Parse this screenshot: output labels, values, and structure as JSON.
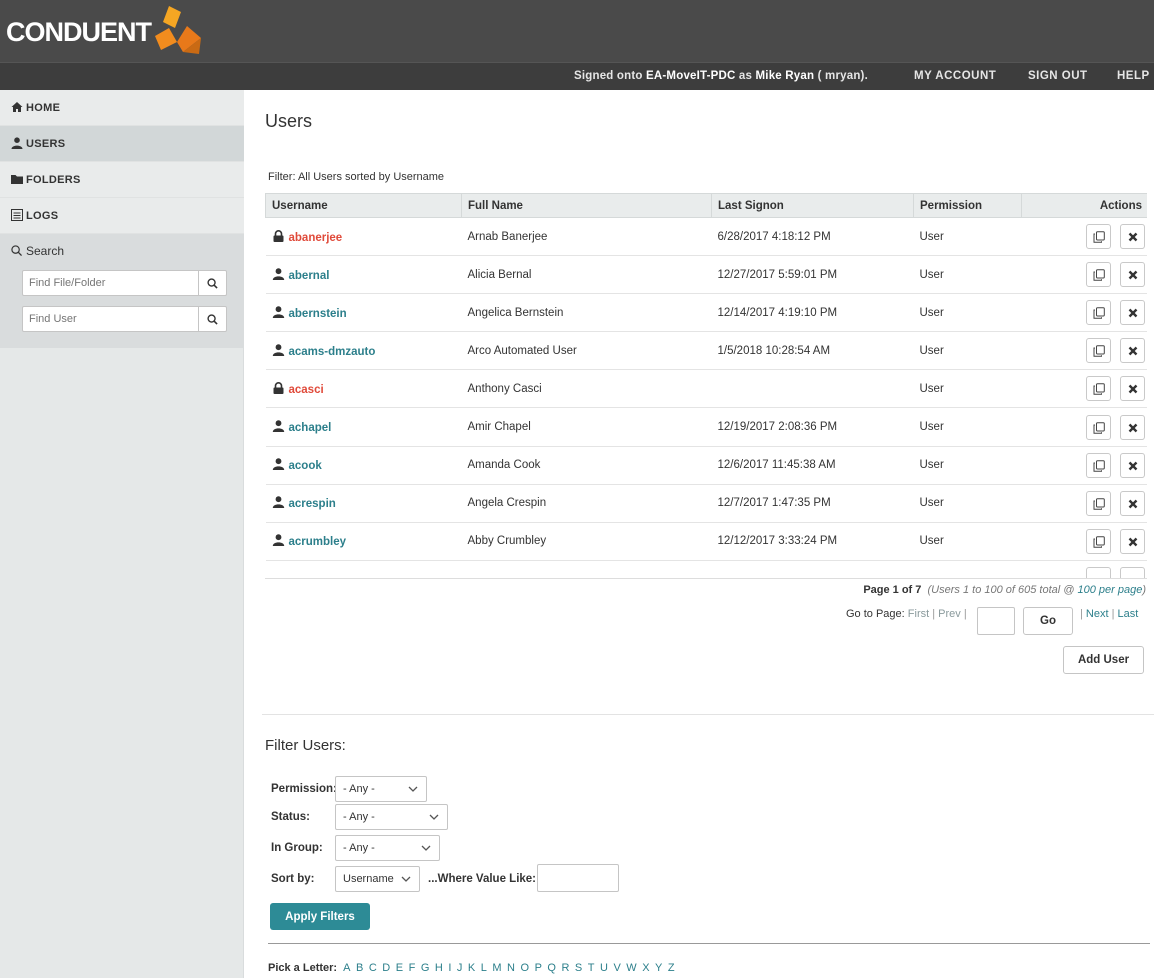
{
  "header": {
    "logo_text": "CONDUENT",
    "signed_prefix": "Signed onto ",
    "server": "EA-MoveIT-PDC",
    "signed_as": " as ",
    "user_display": "Mike Ryan",
    "user_id_text": " ( mryan).",
    "nav": {
      "my_account": "MY ACCOUNT",
      "sign_out": "SIGN OUT",
      "help": "HELP"
    }
  },
  "sidebar": {
    "items": [
      {
        "label": "HOME",
        "icon": "home-icon"
      },
      {
        "label": "USERS",
        "icon": "user-icon"
      },
      {
        "label": "FOLDERS",
        "icon": "folder-icon"
      },
      {
        "label": "LOGS",
        "icon": "logs-icon"
      }
    ],
    "search_title": "Search",
    "find_file_placeholder": "Find File/Folder",
    "find_user_placeholder": "Find User"
  },
  "main": {
    "title": "Users",
    "filter_text": "Filter: All Users sorted by Username",
    "columns": [
      "Username",
      "Full Name",
      "Last Signon",
      "Permission",
      "Actions"
    ],
    "rows": [
      {
        "username": "abanerjee",
        "full_name": "Arnab Banerjee",
        "last_signon": "6/28/2017 4:18:12 PM",
        "permission": "User",
        "locked": true
      },
      {
        "username": "abernal",
        "full_name": "Alicia Bernal",
        "last_signon": "12/27/2017 5:59:01 PM",
        "permission": "User",
        "locked": false
      },
      {
        "username": "abernstein",
        "full_name": "Angelica Bernstein",
        "last_signon": "12/14/2017 4:19:10 PM",
        "permission": "User",
        "locked": false
      },
      {
        "username": "acams-dmzauto",
        "full_name": "Arco Automated User",
        "last_signon": "1/5/2018 10:28:54 AM",
        "permission": "User",
        "locked": false
      },
      {
        "username": "acasci",
        "full_name": "Anthony Casci",
        "last_signon": "",
        "permission": "User",
        "locked": true
      },
      {
        "username": "achapel",
        "full_name": "Amir Chapel",
        "last_signon": "12/19/2017 2:08:36 PM",
        "permission": "User",
        "locked": false
      },
      {
        "username": "acook",
        "full_name": "Amanda Cook",
        "last_signon": "12/6/2017 11:45:38 AM",
        "permission": "User",
        "locked": false
      },
      {
        "username": "acrespin",
        "full_name": "Angela Crespin",
        "last_signon": "12/7/2017 1:47:35 PM",
        "permission": "User",
        "locked": false
      },
      {
        "username": "acrumbley",
        "full_name": "Abby Crumbley",
        "last_signon": "12/12/2017 3:33:24 PM",
        "permission": "User",
        "locked": false
      }
    ],
    "pagination": {
      "page_label": "Page 1 of 7",
      "summary": "(Users 1 to 100 of 605 total @ ",
      "per_page": "100 per page",
      "summary_end": ")",
      "go_to_label": "Go to Page:",
      "first": "First",
      "prev": "Prev",
      "go": "Go",
      "next": "Next",
      "last": "Last"
    },
    "add_user": "Add User"
  },
  "filters": {
    "title": "Filter Users:",
    "permission_label": "Permission:",
    "permission_value": "- Any -",
    "status_label": "Status:",
    "status_value": "- Any -",
    "group_label": "In Group:",
    "group_value": "- Any -",
    "sort_label": "Sort by:",
    "sort_value": "Username",
    "where_label": "...Where Value Like:",
    "apply": "Apply Filters"
  },
  "letters": {
    "label": "Pick a Letter:",
    "items": [
      "A",
      "B",
      "C",
      "D",
      "E",
      "F",
      "G",
      "H",
      "I",
      "J",
      "K",
      "L",
      "M",
      "N",
      "O",
      "P",
      "Q",
      "R",
      "S",
      "T",
      "U",
      "V",
      "W",
      "X",
      "Y",
      "Z"
    ]
  },
  "colors": {
    "accent": "#2d8b96",
    "locked": "#e04a3a",
    "header": "#4a4a4a",
    "logo_orange": "#f28c1e"
  }
}
